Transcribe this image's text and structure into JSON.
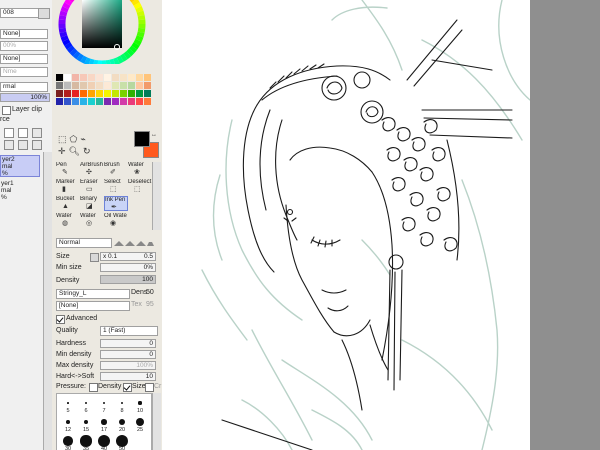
{
  "layer_panel": {
    "top_fields": [
      "008",
      "None]",
      "00%",
      "Nme",
      "None]"
    ],
    "blend_mode": "rmal",
    "opacity": "100%",
    "layer_clip": "Layer clip",
    "source": "rce",
    "layers": [
      {
        "name": "yer2",
        "mode": "mal",
        "opacity": "%"
      },
      {
        "name": "yer1",
        "mode": "mal",
        "opacity": "%"
      }
    ]
  },
  "color": {
    "foreground": "#000000",
    "background": "#ff5a1e",
    "swatches": [
      "#000000",
      "#ffffff",
      "#f2b5a8",
      "#f7c8b8",
      "#f9d7c5",
      "#fbe4d6",
      "#fff3e4",
      "#f2dcc2",
      "#f7e3c6",
      "#ffe9c7",
      "#ffd8a0",
      "#ffc47a",
      "#777777",
      "#bbbbbb",
      "#d6b9a1",
      "#e1c8ae",
      "#f0d0b4",
      "#f3ddc4",
      "#fce9d6",
      "#dfe7b3",
      "#c8e0a8",
      "#b7d89f",
      "#ffc8a0",
      "#f29b6b",
      "#7a1f1f",
      "#b31e1e",
      "#e52222",
      "#ff6a00",
      "#ffa500",
      "#ffd700",
      "#f5f500",
      "#c3e600",
      "#7ad200",
      "#30b000",
      "#009a3f",
      "#007c5a",
      "#2222aa",
      "#3355cc",
      "#3b8ee6",
      "#2ab3e8",
      "#1ad0d0",
      "#27b89d",
      "#7b2bb0",
      "#a02bc0",
      "#d23ba8",
      "#ea3a7a",
      "#ff4a4a",
      "#ff7a3a"
    ]
  },
  "toolbar": {
    "tools": [
      [
        "Pen",
        "AirBrush",
        "Brush",
        "Water"
      ],
      [
        "Marker",
        "Eraser",
        "Select",
        "Deselect"
      ],
      [
        "Bucket",
        "Binary",
        "Ink Pen",
        ""
      ],
      [
        "Water",
        "Water",
        "Oil Wate",
        ""
      ]
    ]
  },
  "brush": {
    "mode": "Normal",
    "size_label": "Size",
    "size_mult": "x 0.1",
    "size_value": "0.5",
    "min_size_label": "Min size",
    "min_size_value": "0%",
    "density_label": "Density",
    "density_value": "100",
    "texture": "Stringy_L",
    "dens_label": "Dens",
    "dens_value": "50",
    "texture2": "[None]",
    "tex_label": "Tex",
    "tex_value": "95",
    "advanced_label": "Advanced",
    "quality_label": "Quality",
    "quality_value": "1 (Fast)",
    "hardness_label": "Hardness",
    "hardness_value": "0",
    "min_density_label": "Min density",
    "min_density_value": "0",
    "max_density_label": "Max density",
    "max_density_value": "100%",
    "hard_soft_label": "Hard<->Soft",
    "hard_soft_value": "10",
    "pressure_label": "Pressure:",
    "pressure_density": "Density",
    "pressure_size": "Size",
    "pressure_blend": "Cr",
    "size_presets": [
      "5",
      "6",
      "7",
      "8",
      "10",
      "12",
      "15",
      "17",
      "20",
      "25",
      "30",
      "35",
      "40",
      "50"
    ]
  }
}
